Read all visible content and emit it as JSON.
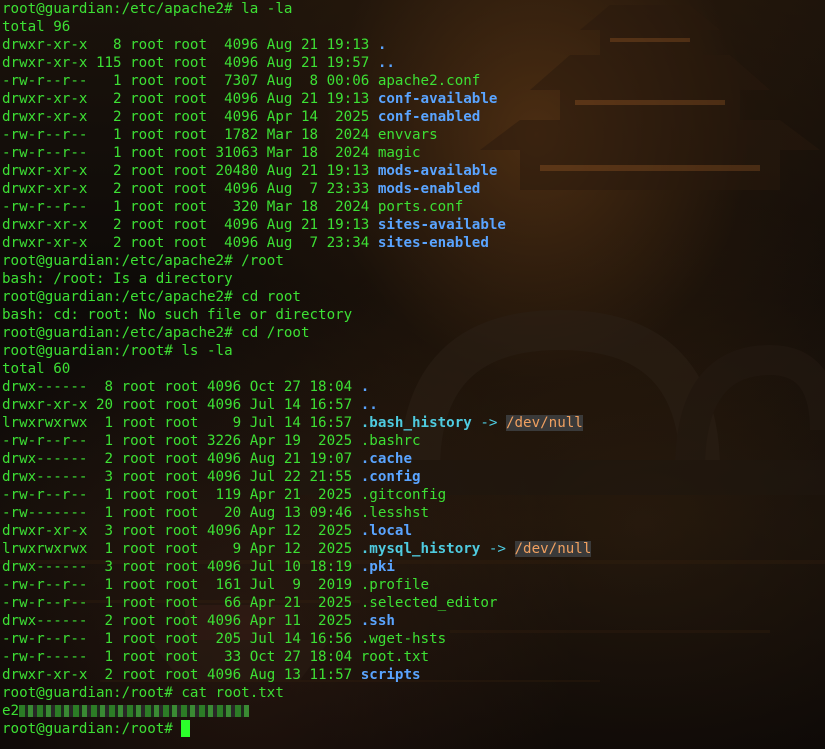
{
  "prompt": "root@guardian:/etc/apache2#",
  "prompt_root": "root@guardian:/root#",
  "cmd1": "la -la",
  "total1": "total 96",
  "listing1": [
    {
      "perm": "drwxr-xr-x",
      "links": "  8",
      "owner": "root",
      "group": "root",
      "size": " 4096",
      "date": "Aug 21 19:13",
      "name": ".",
      "type": "dir"
    },
    {
      "perm": "drwxr-xr-x",
      "links": "115",
      "owner": "root",
      "group": "root",
      "size": " 4096",
      "date": "Aug 21 19:57",
      "name": "..",
      "type": "dir"
    },
    {
      "perm": "-rw-r--r--",
      "links": "  1",
      "owner": "root",
      "group": "root",
      "size": " 7307",
      "date": "Aug  8 00:06",
      "name": "apache2.conf",
      "type": "file"
    },
    {
      "perm": "drwxr-xr-x",
      "links": "  2",
      "owner": "root",
      "group": "root",
      "size": " 4096",
      "date": "Aug 21 19:13",
      "name": "conf-available",
      "type": "dir"
    },
    {
      "perm": "drwxr-xr-x",
      "links": "  2",
      "owner": "root",
      "group": "root",
      "size": " 4096",
      "date": "Apr 14  2025",
      "name": "conf-enabled",
      "type": "dir"
    },
    {
      "perm": "-rw-r--r--",
      "links": "  1",
      "owner": "root",
      "group": "root",
      "size": " 1782",
      "date": "Mar 18  2024",
      "name": "envvars",
      "type": "file"
    },
    {
      "perm": "-rw-r--r--",
      "links": "  1",
      "owner": "root",
      "group": "root",
      "size": "31063",
      "date": "Mar 18  2024",
      "name": "magic",
      "type": "file"
    },
    {
      "perm": "drwxr-xr-x",
      "links": "  2",
      "owner": "root",
      "group": "root",
      "size": "20480",
      "date": "Aug 21 19:13",
      "name": "mods-available",
      "type": "dir"
    },
    {
      "perm": "drwxr-xr-x",
      "links": "  2",
      "owner": "root",
      "group": "root",
      "size": " 4096",
      "date": "Aug  7 23:33",
      "name": "mods-enabled",
      "type": "dir"
    },
    {
      "perm": "-rw-r--r--",
      "links": "  1",
      "owner": "root",
      "group": "root",
      "size": "  320",
      "date": "Mar 18  2024",
      "name": "ports.conf",
      "type": "file"
    },
    {
      "perm": "drwxr-xr-x",
      "links": "  2",
      "owner": "root",
      "group": "root",
      "size": " 4096",
      "date": "Aug 21 19:13",
      "name": "sites-available",
      "type": "dir"
    },
    {
      "perm": "drwxr-xr-x",
      "links": "  2",
      "owner": "root",
      "group": "root",
      "size": " 4096",
      "date": "Aug  7 23:34",
      "name": "sites-enabled",
      "type": "dir"
    }
  ],
  "cmd2": "/root",
  "out2": "bash: /root: Is a directory",
  "cmd3": "cd root",
  "out3": "bash: cd: root: No such file or directory",
  "cmd4": "cd /root",
  "cmd5": "ls -la",
  "total2": "total 60",
  "listing2": [
    {
      "perm": "drwx------",
      "links": " 8",
      "owner": "root",
      "group": "root",
      "size": "4096",
      "date": "Oct 27 18:04",
      "name": ".",
      "type": "dir"
    },
    {
      "perm": "drwxr-xr-x",
      "links": "20",
      "owner": "root",
      "group": "root",
      "size": "4096",
      "date": "Jul 14 16:57",
      "name": "..",
      "type": "dir"
    },
    {
      "perm": "lrwxrwxrwx",
      "links": " 1",
      "owner": "root",
      "group": "root",
      "size": "   9",
      "date": "Jul 14 16:57",
      "name": ".bash_history",
      "type": "link",
      "target": "/dev/null"
    },
    {
      "perm": "-rw-r--r--",
      "links": " 1",
      "owner": "root",
      "group": "root",
      "size": "3226",
      "date": "Apr 19  2025",
      "name": ".bashrc",
      "type": "file"
    },
    {
      "perm": "drwx------",
      "links": " 2",
      "owner": "root",
      "group": "root",
      "size": "4096",
      "date": "Aug 21 19:07",
      "name": ".cache",
      "type": "dir"
    },
    {
      "perm": "drwx------",
      "links": " 3",
      "owner": "root",
      "group": "root",
      "size": "4096",
      "date": "Jul 22 21:55",
      "name": ".config",
      "type": "dir"
    },
    {
      "perm": "-rw-r--r--",
      "links": " 1",
      "owner": "root",
      "group": "root",
      "size": " 119",
      "date": "Apr 21  2025",
      "name": ".gitconfig",
      "type": "file"
    },
    {
      "perm": "-rw-------",
      "links": " 1",
      "owner": "root",
      "group": "root",
      "size": "  20",
      "date": "Aug 13 09:46",
      "name": ".lesshst",
      "type": "file"
    },
    {
      "perm": "drwxr-xr-x",
      "links": " 3",
      "owner": "root",
      "group": "root",
      "size": "4096",
      "date": "Apr 12  2025",
      "name": ".local",
      "type": "dir"
    },
    {
      "perm": "lrwxrwxrwx",
      "links": " 1",
      "owner": "root",
      "group": "root",
      "size": "   9",
      "date": "Apr 12  2025",
      "name": ".mysql_history",
      "type": "link",
      "target": "/dev/null"
    },
    {
      "perm": "drwx------",
      "links": " 3",
      "owner": "root",
      "group": "root",
      "size": "4096",
      "date": "Jul 10 18:19",
      "name": ".pki",
      "type": "dir"
    },
    {
      "perm": "-rw-r--r--",
      "links": " 1",
      "owner": "root",
      "group": "root",
      "size": " 161",
      "date": "Jul  9  2019",
      "name": ".profile",
      "type": "file"
    },
    {
      "perm": "-rw-r--r--",
      "links": " 1",
      "owner": "root",
      "group": "root",
      "size": "  66",
      "date": "Apr 21  2025",
      "name": ".selected_editor",
      "type": "file"
    },
    {
      "perm": "drwx------",
      "links": " 2",
      "owner": "root",
      "group": "root",
      "size": "4096",
      "date": "Apr 11  2025",
      "name": ".ssh",
      "type": "dir"
    },
    {
      "perm": "-rw-r--r--",
      "links": " 1",
      "owner": "root",
      "group": "root",
      "size": " 205",
      "date": "Jul 14 16:56",
      "name": ".wget-hsts",
      "type": "file"
    },
    {
      "perm": "-rw-r-----",
      "links": " 1",
      "owner": "root",
      "group": "root",
      "size": "  33",
      "date": "Oct 27 18:04",
      "name": "root.txt",
      "type": "file"
    },
    {
      "perm": "drwxr-xr-x",
      "links": " 2",
      "owner": "root",
      "group": "root",
      "size": "4096",
      "date": "Aug 13 11:57",
      "name": "scripts",
      "type": "dir"
    }
  ],
  "cmd6": "cat root.txt",
  "flag_prefix": "e2",
  "colors": {
    "green": "#3de034",
    "dir_blue": "#5aa4ff",
    "link_cyan": "#4ecbe0",
    "link_target": "#f0a060",
    "cursor": "#2bff2b"
  }
}
